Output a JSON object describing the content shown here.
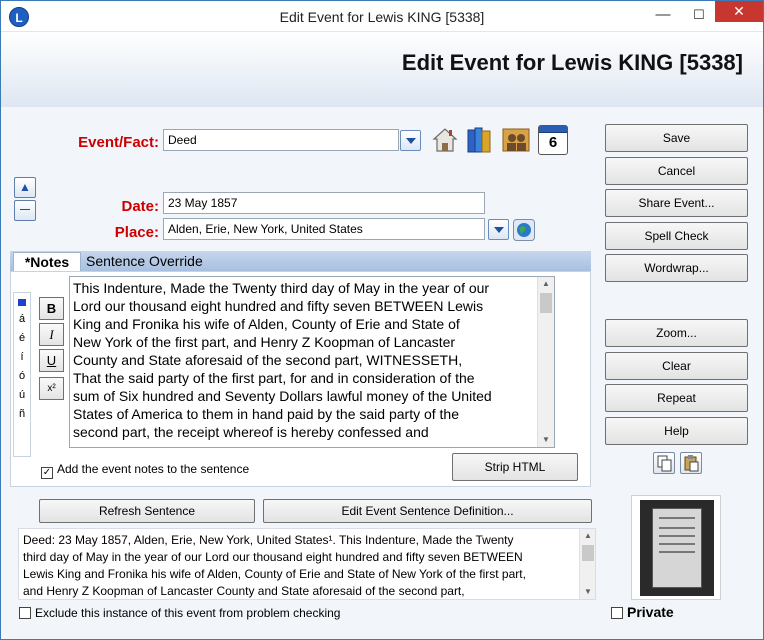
{
  "window": {
    "title": "Edit Event for Lewis KING [5338]",
    "app_icon": "L",
    "minimize": "—",
    "maximize": "☐",
    "close": "✕"
  },
  "header": {
    "title": "Edit Event for Lewis KING [5338]"
  },
  "form": {
    "event_label": "Event/Fact:",
    "event_value": "Deed",
    "date_label": "Date:",
    "date_value": "23 May 1857",
    "place_label": "Place:",
    "place_value": "Alden, Erie, New York, United States",
    "up_arrow": "▲",
    "collapse": "—"
  },
  "icons": {
    "house": "house-icon",
    "books": "books-icon",
    "people": "family-icon",
    "calendar": "calendar-icon",
    "calendar_day": "6",
    "globe": "globe-icon"
  },
  "tabs": {
    "notes": "*Notes",
    "sentence_override": "Sentence Override"
  },
  "accents": [
    "á",
    "é",
    "í",
    "ó",
    "ú",
    "ñ"
  ],
  "format": {
    "bold": "B",
    "italic": "I",
    "underline": "U",
    "superscript": "x²"
  },
  "notes": {
    "lines": [
      "This Indenture, Made the Twenty third day of May in the year of our",
      "Lord our thousand eight hundred and fifty seven BETWEEN Lewis",
      "King and Fronika his wife of Alden, County of Erie and State of",
      "New York of the first part, and Henry Z Koopman of Lancaster",
      "County and State aforesaid of the second part, WITNESSETH,",
      "That the said party of the first part, for and in consideration of the",
      "sum of Six hundred and Seventy Dollars lawful money of the United",
      "States of America to them in hand paid by the said party of the",
      "second part, the receipt whereof is hereby confessed and"
    ],
    "add_to_sentence_label": "Add the event notes to the sentence",
    "add_to_sentence_checked": true,
    "strip_html": "Strip HTML"
  },
  "buttons_right": {
    "save": "Save",
    "cancel": "Cancel",
    "share_event": "Share Event...",
    "spell_check": "Spell Check",
    "wordwrap": "Wordwrap...",
    "zoom": "Zoom...",
    "clear": "Clear",
    "repeat": "Repeat",
    "help": "Help"
  },
  "sentence": {
    "refresh": "Refresh Sentence",
    "edit_definition": "Edit Event Sentence Definition...",
    "lines": [
      "Deed: 23 May 1857, Alden, Erie, New York, United States¹. This Indenture, Made the Twenty",
      "third day of May in the year of our Lord our thousand eight hundred and fifty seven BETWEEN",
      "Lewis King and Fronika his wife of Alden, County of Erie and State of New York of the first part,",
      "and Henry Z Koopman of Lancaster County and State aforesaid of the second part,"
    ],
    "exclude_label": "Exclude this instance of this event from problem checking"
  },
  "private": {
    "label": "Private"
  },
  "colors": {
    "label_red": "#cc0000",
    "accent_blue": "#1f4fa0",
    "tab_bar": "#b4c8e6"
  }
}
